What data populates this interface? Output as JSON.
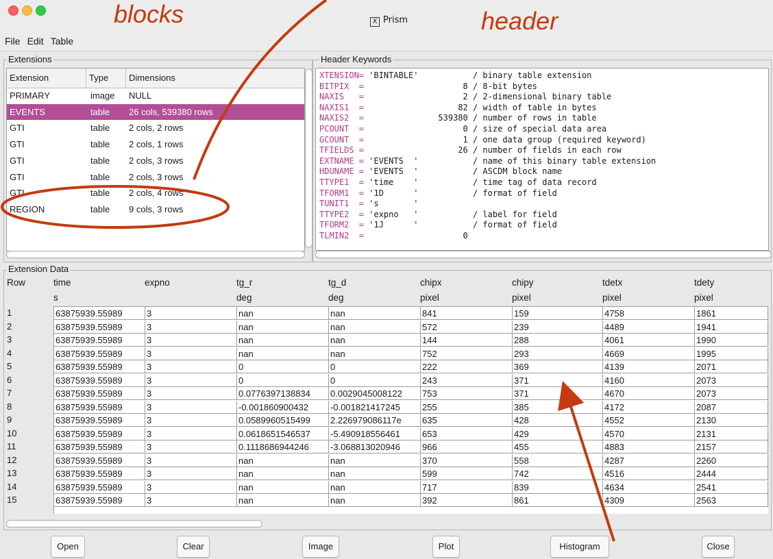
{
  "window": {
    "title": "Prism",
    "title_glyph": "X"
  },
  "annotations": {
    "blocks": "blocks",
    "header": "header"
  },
  "menu": [
    "File",
    "Edit",
    "Table"
  ],
  "extensions": {
    "group_title": "Extensions",
    "columns": [
      "Extension",
      "Type",
      "Dimensions"
    ],
    "rows": [
      {
        "name": "PRIMARY",
        "type": "image",
        "dims": "NULL"
      },
      {
        "name": "EVENTS",
        "type": "table",
        "dims": "26 cols, 539380 rows",
        "selected": true
      },
      {
        "name": "GTI",
        "type": "table",
        "dims": "2 cols, 2 rows"
      },
      {
        "name": "GTI",
        "type": "table",
        "dims": "2 cols, 1 rows"
      },
      {
        "name": "GTI",
        "type": "table",
        "dims": "2 cols, 3 rows"
      },
      {
        "name": "GTI",
        "type": "table",
        "dims": "2 cols, 3 rows"
      },
      {
        "name": "GTI",
        "type": "table",
        "dims": "2 cols, 4 rows"
      },
      {
        "name": "REGION",
        "type": "table",
        "dims": "9 cols, 3 rows"
      }
    ]
  },
  "header_keywords": {
    "group_title": "Header Keywords",
    "lines": [
      {
        "key": "XTENSION=",
        "value": " 'BINTABLE'           / binary table extension"
      },
      {
        "key": "BITPIX  =",
        "value": "                    8 / 8-bit bytes"
      },
      {
        "key": "NAXIS   =",
        "value": "                    2 / 2-dimensional binary table"
      },
      {
        "key": "NAXIS1  =",
        "value": "                   82 / width of table in bytes"
      },
      {
        "key": "NAXIS2  =",
        "value": "               539380 / number of rows in table"
      },
      {
        "key": "PCOUNT  =",
        "value": "                    0 / size of special data area"
      },
      {
        "key": "GCOUNT  =",
        "value": "                    1 / one data group (required keyword)"
      },
      {
        "key": "TFIELDS =",
        "value": "                   26 / number of fields in each row"
      },
      {
        "key": "EXTNAME =",
        "value": " 'EVENTS  '           / name of this binary table extension"
      },
      {
        "key": "HDUNAME =",
        "value": " 'EVENTS  '           / ASCDM block name"
      },
      {
        "key": "TTYPE1  =",
        "value": " 'time    '           / time tag of data record"
      },
      {
        "key": "TFORM1  =",
        "value": " '1D      '           / format of field"
      },
      {
        "key": "TUNIT1  =",
        "value": " 's       '"
      },
      {
        "key": "TTYPE2  =",
        "value": " 'expno   '           / label for field"
      },
      {
        "key": "TFORM2  =",
        "value": " '1J      '           / format of field"
      },
      {
        "key": "TLMIN2  =",
        "value": "                    0"
      }
    ]
  },
  "extension_data": {
    "group_title": "Extension Data",
    "row_label": "Row",
    "columns": [
      {
        "name": "time",
        "unit": "s"
      },
      {
        "name": "expno",
        "unit": ""
      },
      {
        "name": "tg_r",
        "unit": "deg"
      },
      {
        "name": "tg_d",
        "unit": "deg"
      },
      {
        "name": "chipx",
        "unit": "pixel"
      },
      {
        "name": "chipy",
        "unit": "pixel"
      },
      {
        "name": "tdetx",
        "unit": "pixel"
      },
      {
        "name": "tdety",
        "unit": "pixel"
      }
    ],
    "rows": [
      [
        "1",
        "63875939.55989",
        "3",
        "nan",
        "nan",
        "841",
        "159",
        "4758",
        "1861"
      ],
      [
        "2",
        "63875939.55989",
        "3",
        "nan",
        "nan",
        "572",
        "239",
        "4489",
        "1941"
      ],
      [
        "3",
        "63875939.55989",
        "3",
        "nan",
        "nan",
        "144",
        "288",
        "4061",
        "1990"
      ],
      [
        "4",
        "63875939.55989",
        "3",
        "nan",
        "nan",
        "752",
        "293",
        "4669",
        "1995"
      ],
      [
        "5",
        "63875939.55989",
        "3",
        "0",
        "0",
        "222",
        "369",
        "4139",
        "2071"
      ],
      [
        "6",
        "63875939.55989",
        "3",
        "0",
        "0",
        "243",
        "371",
        "4160",
        "2073"
      ],
      [
        "7",
        "63875939.55989",
        "3",
        "0.0776397138834",
        "0.0029045008122",
        "753",
        "371",
        "4670",
        "2073"
      ],
      [
        "8",
        "63875939.55989",
        "3",
        "-0.001860900432",
        "-0.001821417245",
        "255",
        "385",
        "4172",
        "2087"
      ],
      [
        "9",
        "63875939.55989",
        "3",
        "0.0589960515499",
        "2.226979086117e",
        "635",
        "428",
        "4552",
        "2130"
      ],
      [
        "10",
        "63875939.55989",
        "3",
        "0.0618651546537",
        "-5.490918556461",
        "653",
        "429",
        "4570",
        "2131"
      ],
      [
        "11",
        "63875939.55989",
        "3",
        "0.1118686944246",
        "-3.068813020946",
        "966",
        "455",
        "4883",
        "2157"
      ],
      [
        "12",
        "63875939.55989",
        "3",
        "nan",
        "nan",
        "370",
        "558",
        "4287",
        "2260"
      ],
      [
        "13",
        "63875939.55989",
        "3",
        "nan",
        "nan",
        "599",
        "742",
        "4516",
        "2444"
      ],
      [
        "14",
        "63875939.55989",
        "3",
        "nan",
        "nan",
        "717",
        "839",
        "4634",
        "2541"
      ],
      [
        "15",
        "63875939.55989",
        "3",
        "nan",
        "nan",
        "392",
        "861",
        "4309",
        "2563"
      ]
    ]
  },
  "buttons": [
    "Open",
    "Clear",
    "Image",
    "Plot",
    "Histogram",
    "Close"
  ],
  "colors": {
    "selection": "#b14e96",
    "keyword": "#b0388a",
    "annotation": "#c33b0e"
  }
}
